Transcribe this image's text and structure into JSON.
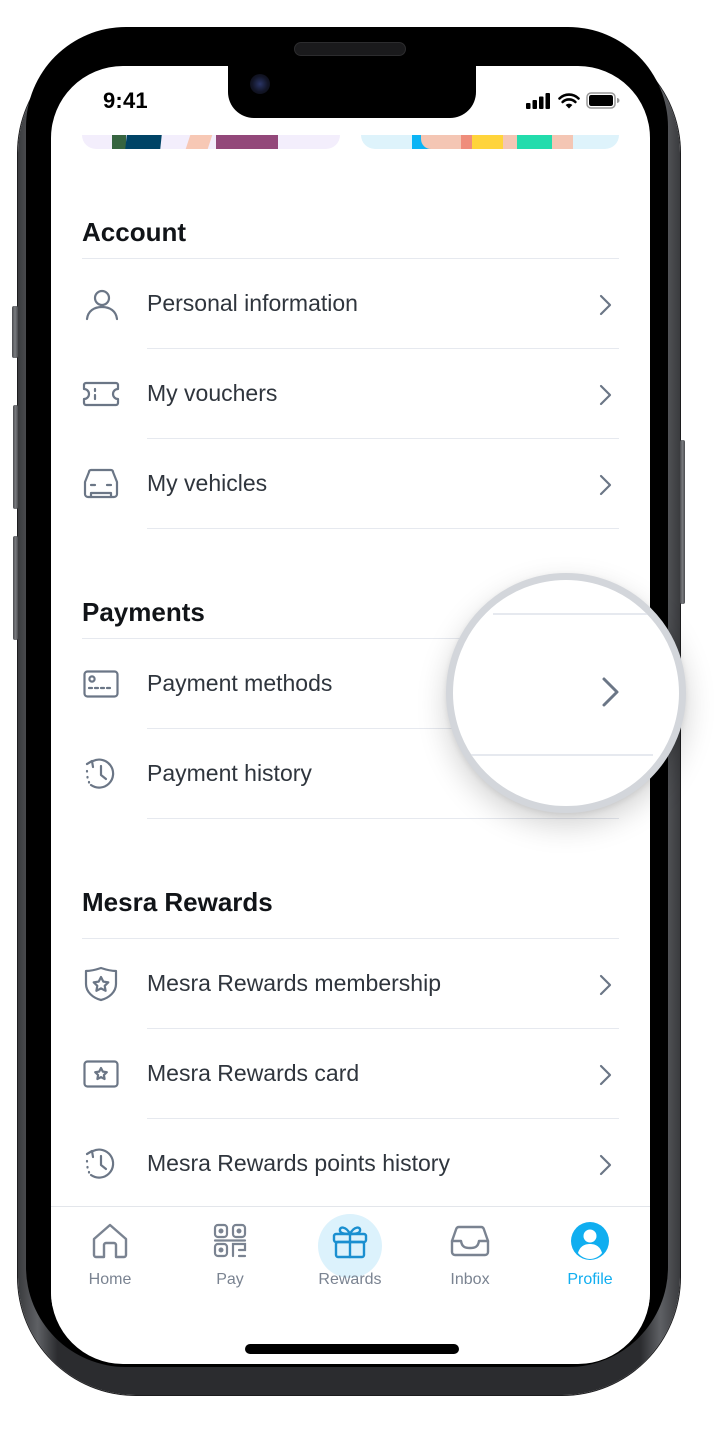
{
  "status_bar": {
    "time": "9:41",
    "icons": [
      "cellular-signal-icon",
      "wifi-icon",
      "battery-icon"
    ]
  },
  "banners": [
    {
      "name": "promo-banner-left",
      "colors": [
        "#f3eefc",
        "#366440",
        "#004466",
        "#f7c8b5",
        "#93487a"
      ]
    },
    {
      "name": "promo-banner-right",
      "colors": [
        "#def3fb",
        "#0bb4f5",
        "#f4c6b4",
        "#ef8d7b",
        "#ffd43b",
        "#22dcac"
      ]
    }
  ],
  "sections": [
    {
      "title": "Account",
      "items": [
        {
          "label": "Personal information",
          "icon": "person-icon"
        },
        {
          "label": "My vouchers",
          "icon": "voucher-ticket-icon"
        },
        {
          "label": "My vehicles",
          "icon": "car-icon"
        }
      ]
    },
    {
      "title": "Payments",
      "items": [
        {
          "label": "Payment methods",
          "icon": "payment-card-icon"
        },
        {
          "label": "Payment history",
          "icon": "history-clock-icon"
        }
      ]
    },
    {
      "title": "Mesra Rewards",
      "items": [
        {
          "label": "Mesra Rewards membership",
          "icon": "shield-star-icon"
        },
        {
          "label": "Mesra Rewards card",
          "icon": "star-card-icon"
        },
        {
          "label": "Mesra Rewards points history",
          "icon": "history-clock-icon"
        }
      ]
    }
  ],
  "tabbar": {
    "active": "Profile",
    "tabs": [
      {
        "label": "Home",
        "icon": "home-icon"
      },
      {
        "label": "Pay",
        "icon": "qr-code-icon"
      },
      {
        "label": "Rewards",
        "icon": "gift-icon"
      },
      {
        "label": "Inbox",
        "icon": "inbox-tray-icon"
      },
      {
        "label": "Profile",
        "icon": "profile-user-icon"
      }
    ]
  },
  "magnifier": {
    "focus": "Payment methods chevron",
    "icon": "chevron-right-icon"
  },
  "colors": {
    "accent": "#10aef0",
    "accent_bg": "#dcf2fc",
    "text_primary": "#111418",
    "text_secondary": "#2f353d",
    "icon_gray": "#6b7686",
    "divider": "#e6e9ef"
  }
}
